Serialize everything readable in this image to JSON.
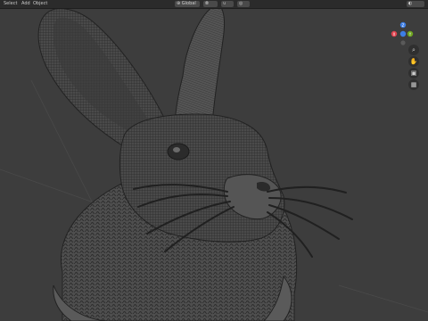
{
  "header": {
    "menus": [
      "Select",
      "Add",
      "Object"
    ],
    "transform_orientation": "Global"
  },
  "gizmo": {
    "axis_x_color": "#e0434f",
    "axis_y_color": "#6fa61f",
    "axis_z_color": "#3d7ee6",
    "axis_x_label": "X",
    "axis_y_label": "Y",
    "axis_z_label": "Z"
  },
  "nav_icons": [
    "zoom-icon",
    "pan-hand-icon",
    "camera-icon",
    "grid-icon"
  ],
  "scene": {
    "subject": "sculpted rabbit bust with whiskers (wireframe overlay)",
    "background_color": "#3d3d3d"
  }
}
